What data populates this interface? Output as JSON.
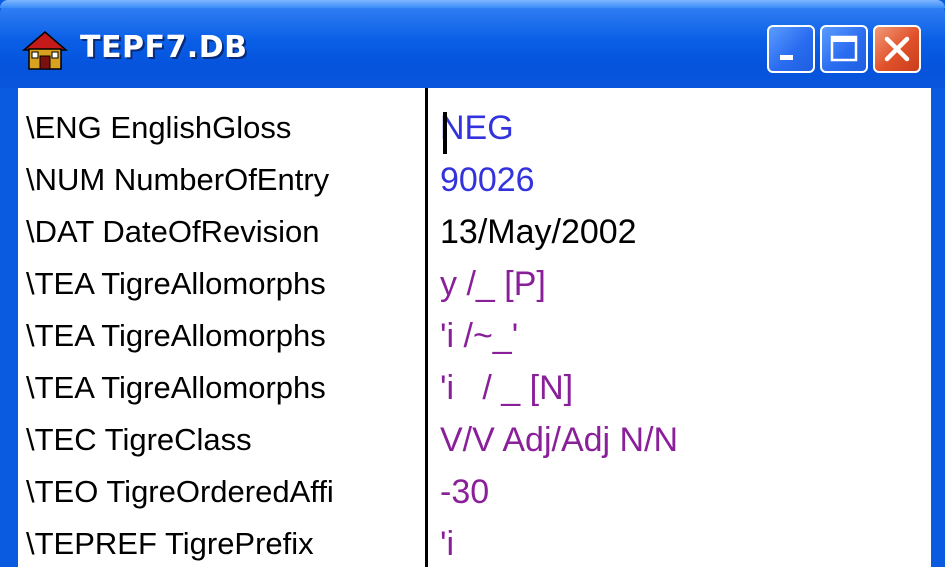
{
  "window": {
    "title": "TEPF7.DB",
    "colors": {
      "titlebar": "#0a5be0",
      "close_button": "#e0512a",
      "blue_value": "#3333dd",
      "purple_value": "#8a1f9a"
    }
  },
  "fields": [
    {
      "marker": "\\ENG EnglishGloss",
      "value": "NEG",
      "color": "#3333dd"
    },
    {
      "marker": "\\NUM NumberOfEntry",
      "value": "90026",
      "color": "#3333dd"
    },
    {
      "marker": "\\DAT DateOfRevision",
      "value": "13/May/2002",
      "color": "#000000"
    },
    {
      "marker": "\\TEA TigreAllomorphs",
      "value": "y /_ [P]",
      "color": "#8a1f9a"
    },
    {
      "marker": "\\TEA TigreAllomorphs",
      "value": "'i /~_'",
      "color": "#8a1f9a"
    },
    {
      "marker": "\\TEA TigreAllomorphs",
      "value": "'i   / _ [N]",
      "color": "#8a1f9a"
    },
    {
      "marker": "\\TEC TigreClass",
      "value": "V/V Adj/Adj N/N",
      "color": "#8a1f9a"
    },
    {
      "marker": "\\TEO TigreOrderedAffi",
      "value": "-30",
      "color": "#8a1f9a"
    },
    {
      "marker": "\\TEPREF TigrePrefix",
      "value": "'i",
      "color": "#8a1f9a"
    }
  ]
}
